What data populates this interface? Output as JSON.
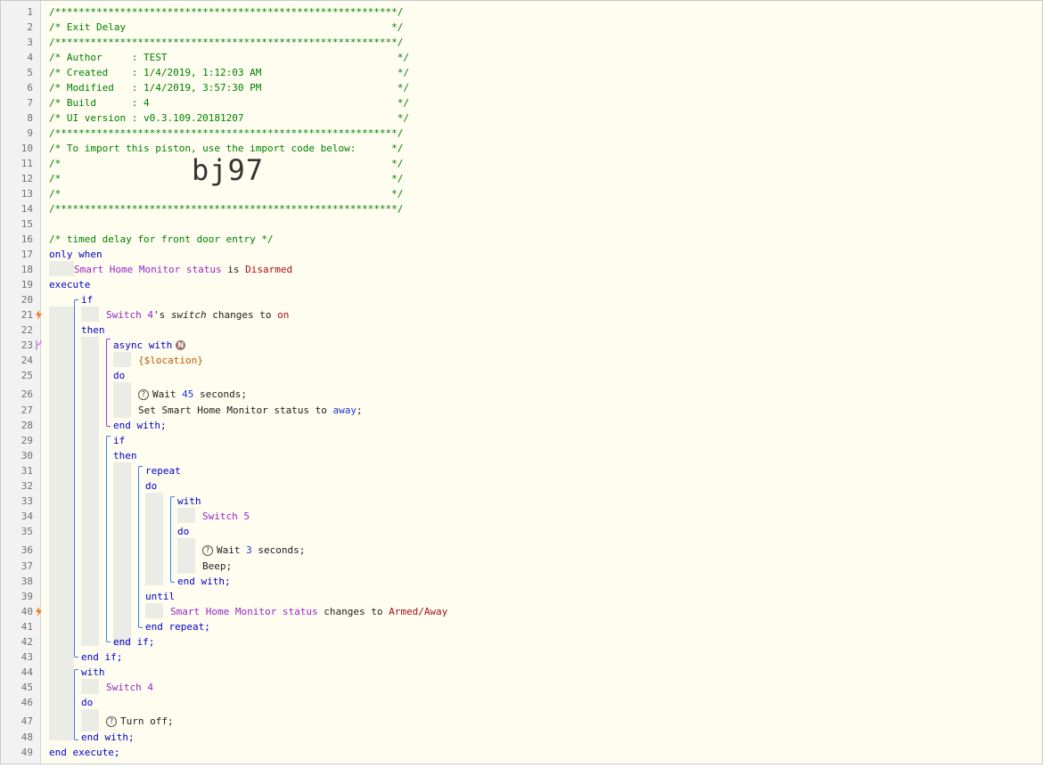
{
  "editor": {
    "comment": {
      "l1": "/**********************************************************/",
      "l2": "/* Exit Delay                                             */",
      "l3": "/**********************************************************/",
      "l4": "/* Author     : TEST                                       */",
      "l5": "/* Created    : 1/4/2019, 1:12:03 AM                       */",
      "l6": "/* Modified   : 1/4/2019, 3:57:30 PM                       */",
      "l7": "/* Build      : 4                                          */",
      "l8": "/* UI version : v0.3.109.20181207                          */",
      "l9": "/**********************************************************/",
      "l10": "/* To import this piston, use the import code below:      */",
      "l11": "/*                                                        */",
      "l12": "/*                                                        */",
      "l13": "/*                                                        */",
      "l14": "/**********************************************************/",
      "import_code": "bj97",
      "l16": "/* timed delay for front door entry */"
    },
    "tokens": {
      "only_when": "only when",
      "shm_device": "Smart Home Monitor",
      "shm_attr": "status",
      "is": "is",
      "disarmed": "Disarmed",
      "execute": "execute",
      "if": "if",
      "switch4": "Switch 4",
      "possessive": "'s",
      "switch_attr": "switch",
      "changes_to": "changes to",
      "on": "on",
      "then": "then",
      "async_with": "async with",
      "badge_n": "N",
      "location": "{$location}",
      "do": "do",
      "wait": "Wait",
      "n45": "45",
      "seconds": "seconds;",
      "set_shm": "Set Smart Home Monitor status to",
      "away": "away",
      "semi": ";",
      "end_with": "end with;",
      "repeat": "repeat",
      "with": "with",
      "switch5": "Switch 5",
      "n3": "3",
      "beep": "Beep;",
      "until": "until",
      "armed_away": "Armed/Away",
      "end_repeat": "end repeat;",
      "end_if": "end if;",
      "turn_off": "Turn off;",
      "end_execute": "end execute;",
      "help_glyph": "?"
    },
    "line_numbers": [
      "1",
      "2",
      "3",
      "4",
      "5",
      "6",
      "7",
      "8",
      "9",
      "10",
      "11",
      "12",
      "13",
      "14",
      "15",
      "16",
      "17",
      "18",
      "19",
      "20",
      "21",
      "22",
      "23",
      "24",
      "25",
      "26",
      "27",
      "28",
      "29",
      "30",
      "31",
      "32",
      "33",
      "34",
      "35",
      "36",
      "37",
      "38",
      "39",
      "40",
      "41",
      "42",
      "43",
      "44",
      "45",
      "46",
      "47",
      "48",
      "49"
    ],
    "colors": {
      "comment": "#008000",
      "keyword": "#0000cc",
      "device": "#9b25c7",
      "value": "#a41014",
      "number": "#1f38d6",
      "bracket": "#3b7ef0",
      "async_bracket": "#a238d8",
      "trigger_icon": "#f07a2a"
    }
  }
}
